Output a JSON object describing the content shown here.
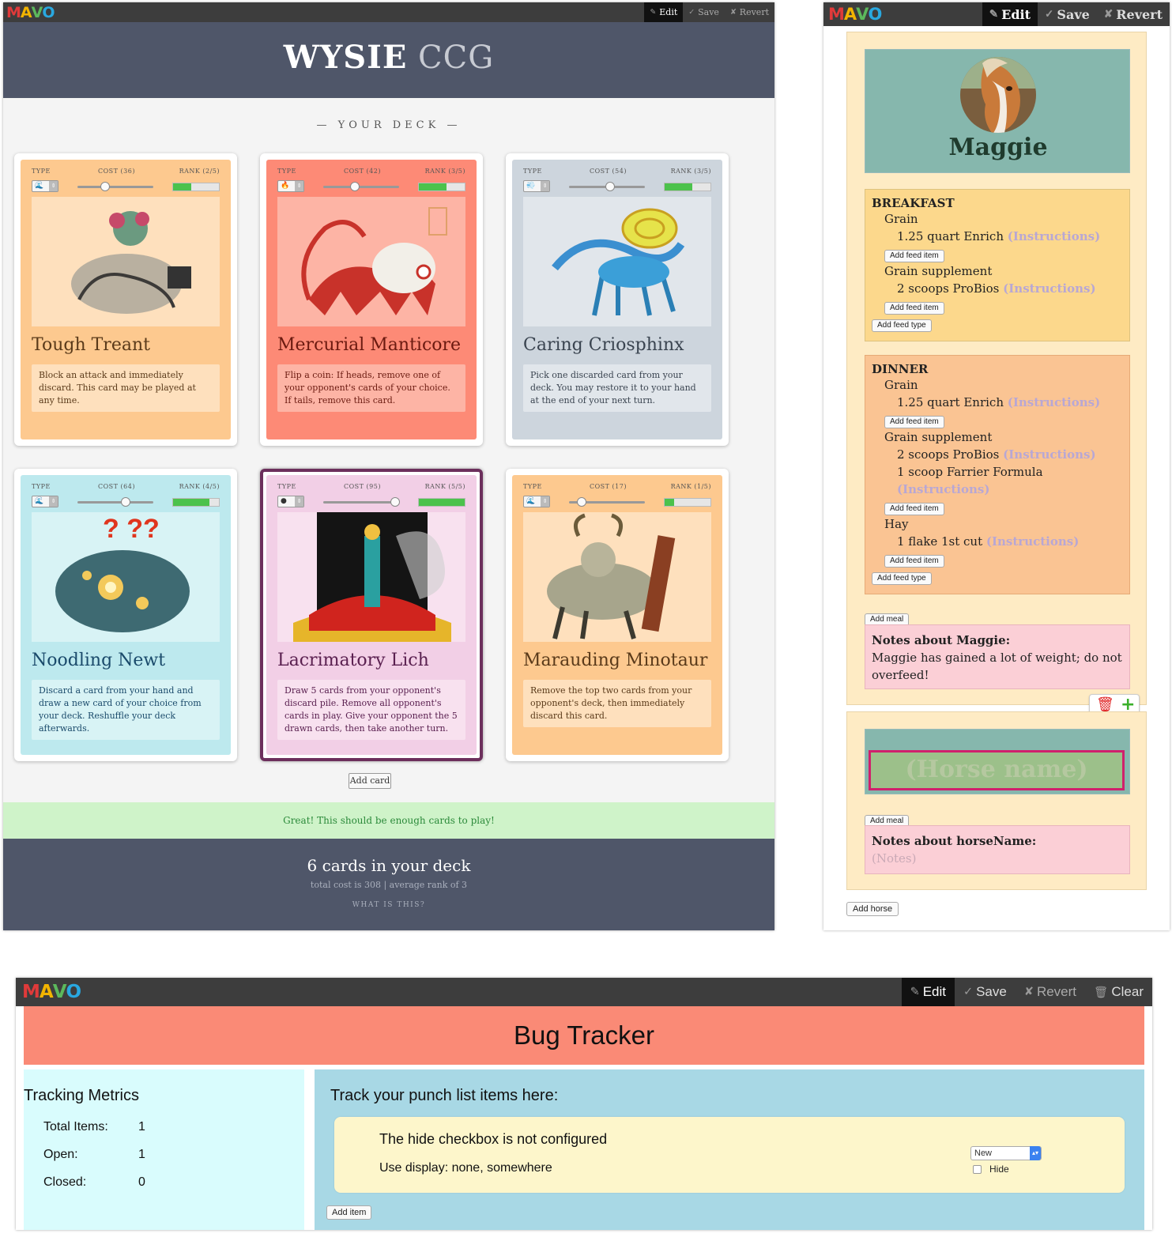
{
  "mavo_logo": "MAVO",
  "wysie": {
    "toolbar": {
      "edit": "Edit",
      "save": "Save",
      "revert": "Revert"
    },
    "title_bold": "WYSIE",
    "title_light": "CCG",
    "deck_heading": "— YOUR DECK —",
    "cards": [
      {
        "type_label": "TYPE",
        "cost_label": "COST (36)",
        "rank_label": "RANK (2/5)",
        "cost": 36,
        "rank": 2,
        "name": "Tough Treant",
        "description": "Block an attack and immediately discard. This card may be played at any time.",
        "bg": "#fdc98f",
        "desc_bg": "#fee0bd",
        "name_color": "#5a3a1a",
        "type_icon": "water-icon"
      },
      {
        "type_label": "TYPE",
        "cost_label": "COST (42)",
        "rank_label": "RANK (3/5)",
        "cost": 42,
        "rank": 3,
        "name": "Mercurial Manticore",
        "description": "Flip a coin: If heads, remove one of your opponent's cards of your choice. If tails, remove this card.",
        "bg": "#fd8a76",
        "desc_bg": "#fdb4a5",
        "name_color": "#6b1a10",
        "type_icon": "fire-icon"
      },
      {
        "type_label": "TYPE",
        "cost_label": "COST (54)",
        "rank_label": "RANK (3/5)",
        "cost": 54,
        "rank": 3,
        "name": "Caring Criosphinx",
        "description": "Pick one discarded card from your deck. You may restore it to your hand at the end of your next turn.",
        "bg": "#cdd5dd",
        "desc_bg": "#e1e6eb",
        "name_color": "#3a4450",
        "type_icon": "air-icon"
      },
      {
        "type_label": "TYPE",
        "cost_label": "COST (64)",
        "rank_label": "RANK (4/5)",
        "cost": 64,
        "rank": 4,
        "name": "Noodling Newt",
        "description": "Discard a card from your hand and draw a new card of your choice from your deck. Reshuffle your deck afterwards.",
        "bg": "#bde9ee",
        "desc_bg": "#d8f3f5",
        "name_color": "#1a4a6b",
        "type_icon": "water-icon"
      },
      {
        "type_label": "TYPE",
        "cost_label": "COST (95)",
        "rank_label": "RANK (5/5)",
        "cost": 95,
        "rank": 5,
        "name": "Lacrimatory Lich",
        "description": "Draw 5 cards from your opponent's discard pile. Remove all opponent's cards in play. Give your opponent the 5 drawn cards, then take another turn.",
        "bg": "#f2cfe6",
        "desc_bg": "#f8e1ef",
        "name_color": "#5a2050",
        "type_icon": "dark-icon"
      },
      {
        "type_label": "TYPE",
        "cost_label": "COST (17)",
        "rank_label": "RANK (1/5)",
        "cost": 17,
        "rank": 1,
        "name": "Marauding Minotaur",
        "description": "Remove the top two cards from your opponent's deck, then immediately discard this card.",
        "bg": "#fdc98f",
        "desc_bg": "#fee0bd",
        "name_color": "#5a3a1a",
        "type_icon": "water-icon"
      }
    ],
    "add_card": "Add card",
    "banner": "Great! This should be enough cards to play!",
    "deck_count": "6 cards in your deck",
    "deck_stats": "total cost is 308  |  average rank of 3",
    "what_is": "WHAT IS THIS?"
  },
  "horse": {
    "toolbar": {
      "edit": "Edit",
      "save": "Save",
      "revert": "Revert"
    },
    "name": "Maggie",
    "breakfast": {
      "title": "BREAKFAST",
      "feeds": [
        {
          "type": "Grain",
          "items": [
            {
              "text": "1.25 quart Enrich",
              "link": "(Instructions)"
            }
          ]
        },
        {
          "type": "Grain supplement",
          "items": [
            {
              "text": "2 scoops ProBios",
              "link": "(Instructions)"
            }
          ]
        }
      ]
    },
    "dinner": {
      "title": "DINNER",
      "feeds": [
        {
          "type": "Grain",
          "items": [
            {
              "text": "1.25 quart Enrich",
              "link": "(Instructions)"
            }
          ]
        },
        {
          "type": "Grain supplement",
          "items": [
            {
              "text": "2 scoops ProBios",
              "link": "(Instructions)"
            },
            {
              "text": "1 scoop Farrier Formula",
              "link": "(Instructions)"
            }
          ]
        },
        {
          "type": "Hay",
          "items": [
            {
              "text": "1 flake 1st cut",
              "link": "(Instructions)"
            }
          ]
        }
      ]
    },
    "add_feed_item": "Add feed item",
    "add_feed_type": "Add feed type",
    "add_meal": "Add meal",
    "notes_heading": "Notes about Maggie:",
    "notes_text": "Maggie has gained a lot of weight; do not overfeed!",
    "new_horse_placeholder": "(Horse name)",
    "new_notes_heading": "Notes about horseName:",
    "new_notes_placeholder": "(Notes)",
    "add_horse": "Add horse"
  },
  "bug": {
    "toolbar": {
      "edit": "Edit",
      "save": "Save",
      "revert": "Revert",
      "clear": "Clear"
    },
    "title": "Bug Tracker",
    "metrics_heading": "Tracking Metrics",
    "metrics": [
      {
        "label": "Total Items:",
        "value": "1"
      },
      {
        "label": "Open:",
        "value": "1"
      },
      {
        "label": "Closed:",
        "value": "0"
      }
    ],
    "main_heading": "Track your punch list items here:",
    "item_title": "The hide checkbox is not configured",
    "item_desc": "Use display: none, somewhere",
    "status": "New",
    "hide_label": "Hide",
    "add_item": "Add item"
  }
}
